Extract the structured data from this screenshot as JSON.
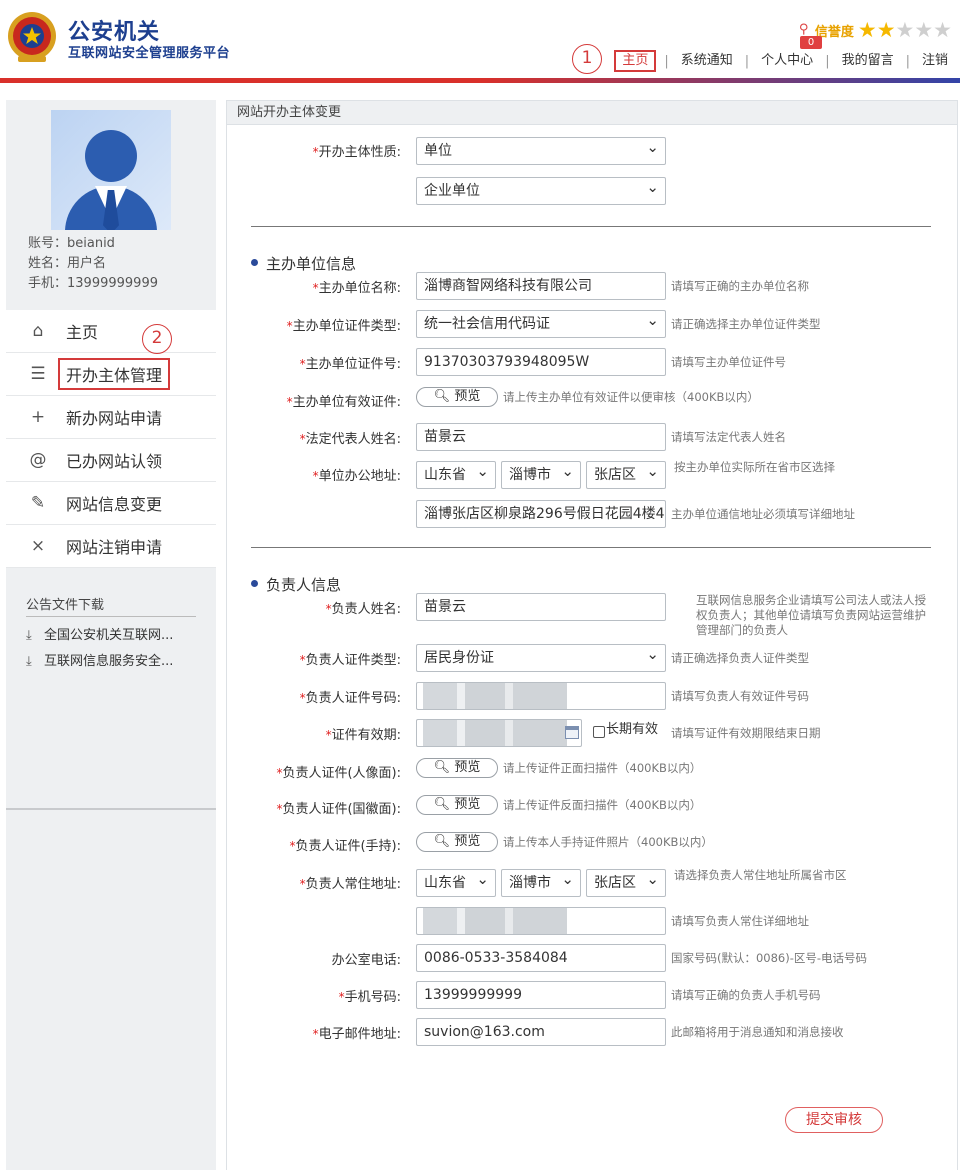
{
  "header": {
    "logo_title": "公安机关",
    "logo_sub": "互联网站安全管理服务平台",
    "credit_label": "信誉度",
    "credit_stars_on": 2,
    "credit_stars_total": 5,
    "message_count": "0",
    "nav": [
      {
        "label": "主页",
        "active": true
      },
      {
        "label": "系统通知",
        "active": false
      },
      {
        "label": "个人中心",
        "active": false
      },
      {
        "label": "我的留言",
        "active": false
      },
      {
        "label": "注销",
        "active": false
      }
    ],
    "colors": {
      "brand_blue": "#1d3f8f",
      "accent_red": "#d43a3a"
    }
  },
  "annotations": {
    "one": "1",
    "two": "2"
  },
  "sidebar": {
    "account_line": "账号：beianid",
    "name_line": "姓名：用户名",
    "phone_line": "手机：13999999999",
    "menu": [
      {
        "icon": "home-icon",
        "glyph": "⌂",
        "label": "主页"
      },
      {
        "icon": "list-icon",
        "glyph": "☰",
        "label": "开办主体管理"
      },
      {
        "icon": "plus-icon",
        "glyph": "+",
        "label": "新办网站申请"
      },
      {
        "icon": "at-icon",
        "glyph": "@",
        "label": "已办网站认领"
      },
      {
        "icon": "edit-icon",
        "glyph": "✎",
        "label": "网站信息变更"
      },
      {
        "icon": "close-icon",
        "glyph": "×",
        "label": "网站注销申请"
      }
    ],
    "downloads_title": "公告文件下载",
    "downloads": [
      "全国公安机关互联网...",
      "互联网信息服务安全..."
    ]
  },
  "panel": {
    "title": "网站开办主体变更",
    "nature_label": "开办主体性质:",
    "nature_value": "单位",
    "nature_sub_value": "企业单位",
    "sponsor_section": "主办单位信息",
    "sponsor_name_label": "主办单位名称:",
    "sponsor_name_value": "淄博商智网络科技有限公司",
    "sponsor_name_hint": "请填写正确的主办单位名称",
    "sponsor_idtype_label": "主办单位证件类型:",
    "sponsor_idtype_value": "统一社会信用代码证",
    "sponsor_idtype_hint": "请正确选择主办单位证件类型",
    "sponsor_idno_label": "主办单位证件号:",
    "sponsor_idno_value": "91370303793948095W",
    "sponsor_idno_hint": "请填写主办单位证件号",
    "sponsor_cert_label": "主办单位有效证件:",
    "preview_label": "预览",
    "sponsor_cert_hint": "请上传主办单位有效证件以便审核（400KB以内）",
    "legal_label": "法定代表人姓名:",
    "legal_value": "苗景云",
    "legal_hint": "请填写法定代表人姓名",
    "office_addr_label": "单位办公地址:",
    "province": "山东省",
    "city": "淄博市",
    "district": "张店区",
    "office_addr_hint": "按主办单位实际所在省市区选择",
    "office_addr_detail": "淄博张店区柳泉路296号假日花园4楼4",
    "office_addr_detail_hint": "主办单位通信地址必须填写详细地址",
    "owner_section": "负责人信息",
    "owner_name_label": "负责人姓名:",
    "owner_name_value": "苗景云",
    "owner_name_hint": "互联网信息服务企业请填写公司法人或法人授权负责人；其他单位请填写负责网站运营维护管理部门的负责人",
    "owner_idtype_label": "负责人证件类型:",
    "owner_idtype_value": "居民身份证",
    "owner_idtype_hint": "请正确选择负责人证件类型",
    "owner_idno_label": "负责人证件号码:",
    "owner_idno_hint": "请填写负责人有效证件号码",
    "validity_label": "证件有效期:",
    "longterm_label": "长期有效",
    "validity_hint": "请填写证件有效期限结束日期",
    "cert_front_label": "负责人证件(人像面):",
    "cert_front_hint": "请上传证件正面扫描件（400KB以内）",
    "cert_back_label": "负责人证件(国徽面):",
    "cert_back_hint": "请上传证件反面扫描件（400KB以内）",
    "cert_hand_label": "负责人证件(手持):",
    "cert_hand_hint": "请上传本人手持证件照片（400KB以内）",
    "home_addr_label": "负责人常住地址:",
    "home_addr_hint": "请选择负责人常住地址所属省市区",
    "home_addr_detail_hint": "请填写负责人常住详细地址",
    "office_tel_label": "办公室电话:",
    "office_tel_value": "0086-0533-3584084",
    "office_tel_hint": "国家号码(默认：0086)-区号-电话号码",
    "mobile_label": "手机号码:",
    "mobile_value": "13999999999",
    "mobile_hint": "请填写正确的负责人手机号码",
    "email_label": "电子邮件地址:",
    "email_value": "suvion@163.com",
    "email_hint": "此邮箱将用于消息通知和消息接收",
    "submit_label": "提交审核"
  }
}
